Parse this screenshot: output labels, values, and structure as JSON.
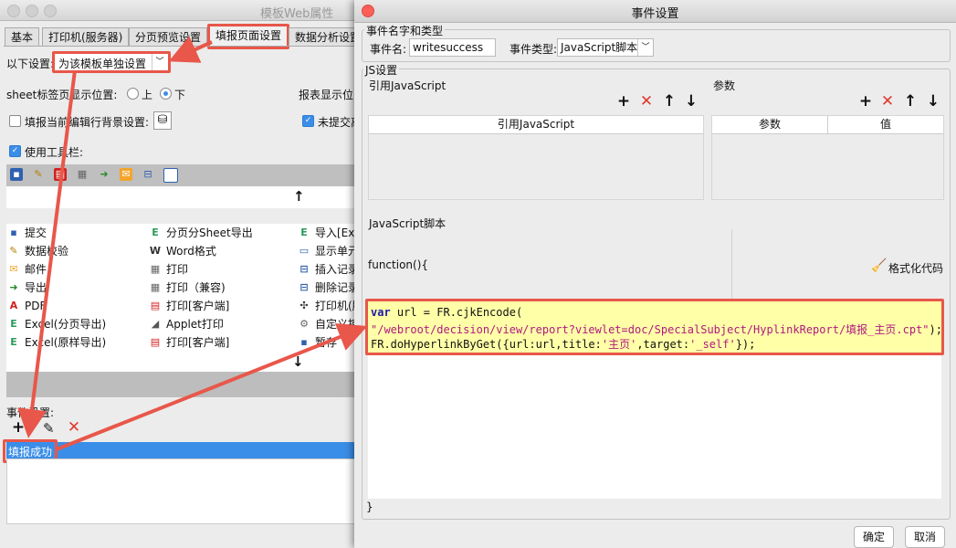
{
  "left_window": {
    "title": "模板Web属性",
    "tabs": [
      "基本",
      "打印机(服务器)",
      "分页预览设置",
      "填报页面设置",
      "数据分析设置"
    ],
    "following_settings_label": "以下设置:",
    "following_settings_value": "为该模板单独设置",
    "sheet_tab_position_label": "sheet标签页显示位置:",
    "position_top": "上",
    "position_bottom": "下",
    "report_display_label": "报表显示位",
    "fill_bg_label": "填报当前编辑行背景设置:",
    "unsubmitted_label": "未提交离",
    "use_toolbar_label": "使用工具栏:",
    "arrow_up": "↑",
    "arrow_down": "↓",
    "grid": [
      [
        "提交",
        "分页分Sheet导出",
        "导入[Ex"
      ],
      [
        "数据校验",
        "Word格式",
        "显示单元"
      ],
      [
        "邮件",
        "打印",
        "插入记录"
      ],
      [
        "导出",
        "打印（兼容)",
        "删除记录"
      ],
      [
        "PDF",
        "打印[客户端]",
        "打印机(服"
      ],
      [
        "Excel(分页导出)",
        "Applet打印",
        "自定义控"
      ],
      [
        "Excel(原样导出)",
        "打印[客户端]",
        "暂存"
      ]
    ],
    "event_settings_label": "事件设置:",
    "event_item": "填报成功"
  },
  "dialog": {
    "title": "事件设置",
    "section_event": "事件名字和类型",
    "event_name_label": "事件名:",
    "event_name_value": "writesuccess",
    "event_type_label": "事件类型:",
    "event_type_value": "JavaScript脚本",
    "section_js": "JS设置",
    "ref_js_label": "引用JavaScript",
    "params_label": "参数",
    "ref_js_header": "引用JavaScript",
    "params_header_param": "参数",
    "params_header_value": "值",
    "js_script_label": "JavaScript脚本",
    "function_open": "function(){",
    "format_code": "格式化代码",
    "code": {
      "kw_var": "var",
      "line1_mid": " url = FR.cjkEncode(",
      "line2_str": "\"/webroot/decision/view/report?viewlet=doc/SpecialSubject/HyplinkReport/填报_主页.cpt\"",
      "line2_end": ");",
      "line3_a": "FR.doHyperlinkByGet({url:url,title:",
      "line3_s1": "'主页'",
      "line3_b": ",target:",
      "line3_s2": "'_self'",
      "line3_c": "});"
    },
    "function_close": "}",
    "ok": "确定",
    "cancel": "取消"
  },
  "colors": {
    "accent_red": "#e8574a",
    "selection_blue": "#3b8ee8",
    "keyword": "#1a1aa6",
    "string": "#b0197e",
    "highlight": "#ffffa8"
  }
}
